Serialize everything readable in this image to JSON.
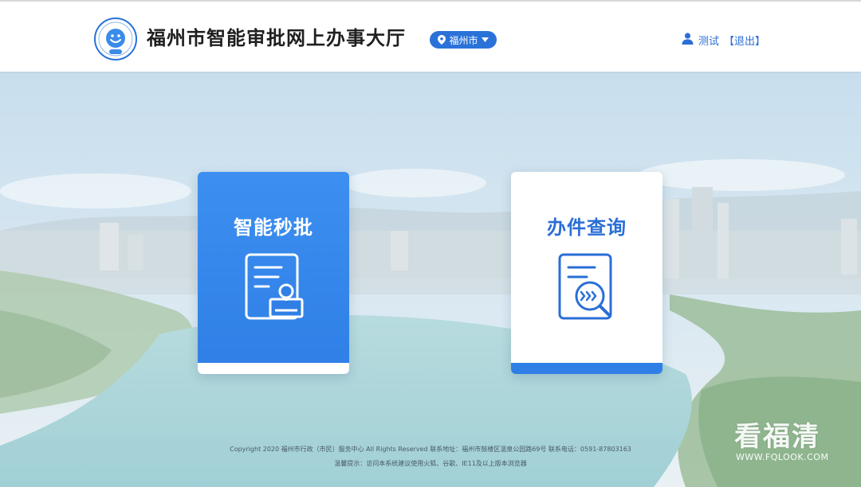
{
  "header": {
    "site_title": "福州市智能审批网上办事大厅",
    "logo_alt": "logo",
    "city_select": {
      "value": "福州市"
    },
    "user": {
      "name": "测试",
      "logout_label": "【退出】"
    }
  },
  "cards": [
    {
      "title": "智能秒批",
      "icon": "document-stamp-icon"
    },
    {
      "title": "办件查询",
      "icon": "document-search-icon"
    }
  ],
  "footer": {
    "copyright": "Copyright 2020 福州市行政（市民）服务中心 All Rights Reserved 联系地址：福州市鼓楼区温泉公园路69号 联系电话：0591-87803163",
    "tip": "温馨提示：访问本系统建议使用火狐、谷歌、IE11及以上版本浏览器"
  },
  "watermark": {
    "text": "看福清",
    "url": "WWW.FQLOOK.COM"
  },
  "colors": {
    "accent_blue": "#2f7fe6",
    "title_text": "#1f1f1f",
    "link_blue": "#2a6ed6",
    "header_bg": "#ffffff"
  }
}
